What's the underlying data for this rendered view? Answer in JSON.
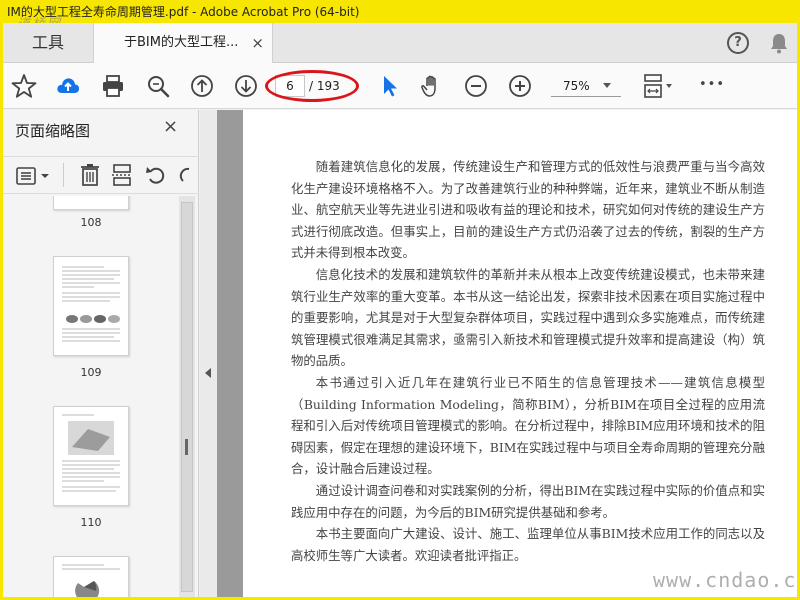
{
  "window": {
    "title": "IM的大型工程全寿命周期管理.pdf - Adobe Acrobat Pro (64-bit)",
    "watermark_top": "道桥网",
    "watermark_bottom": "www.cndao.com"
  },
  "tabs": {
    "tools_label": "工具",
    "document_label": "于BIM的大型工程...",
    "close_glyph": "×",
    "help_glyph": "?"
  },
  "toolbar": {
    "page_current": "6",
    "page_total": "/ 193",
    "zoom": "75%",
    "more_glyph": "•••",
    "highlight_color": "#d9161b",
    "accent_color": "#1473e6"
  },
  "left_panel": {
    "title": "页面缩略图",
    "close_glyph": "×",
    "thumbnails": [
      {
        "label": "108"
      },
      {
        "label": "109"
      },
      {
        "label": "110"
      }
    ]
  },
  "document": {
    "paragraphs": [
      "随着建筑信息化的发展，传统建设生产和管理方式的低效性与浪费严重与当今高效化生产建设环境格格不入。为了改善建筑行业的种种弊端，近年来，建筑业不断从制造业、航空航天业等先进业引进和吸收有益的理论和技术，研究如何对传统的建设生产方式进行彻底改造。但事实上，目前的建设生产方式仍沿袭了过去的传统，割裂的生产方式并未得到根本改变。",
      "信息化技术的发展和建筑软件的革新并未从根本上改变传统建设模式，也未带来建筑行业生产效率的重大变革。本书从这一结论出发，探索非技术因素在项目实施过程中的重要影响，尤其是对于大型复杂群体项目，实践过程中遇到众多实施难点，而传统建筑管理模式很难满足其需求，亟需引入新技术和管理模式提升效率和提高建设（构）筑物的品质。",
      "本书通过引入近几年在建筑行业已不陌生的信息管理技术——建筑信息模型（Building Information Modeling，简称BIM），分析BIM在项目全过程的应用流程和引入后对传统项目管理模式的影响。在分析过程中，排除BIM应用环境和技术的阻碍因素，假定在理想的建设环境下，BIM在实践过程中与项目全寿命周期的管理充分融合，设计融合后建设过程。",
      "通过设计调查问卷和对实践案例的分析，得出BIM在实践过程中实际的价值点和实践应用中存在的问题，为今后的BIM研究提供基础和参考。",
      "本书主要面向广大建设、设计、施工、监理单位从事BIM技术应用工作的同志以及高校师生等广大读者。欢迎读者批评指正。"
    ]
  }
}
